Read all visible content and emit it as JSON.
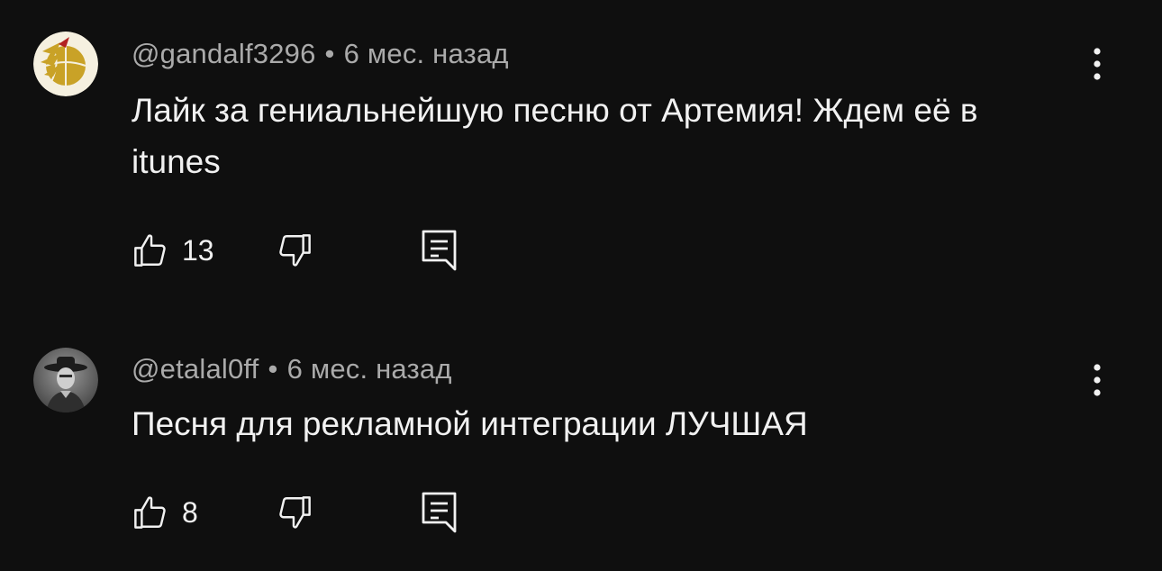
{
  "comments": [
    {
      "author": "@gandalf3296",
      "separator": "•",
      "time": "6 мес. назад",
      "text": "Лайк за гениальнейшую песню от Артемия! Ждем её в itunes",
      "likes": "13",
      "avatar_icon": "raptors-claw-basketball-icon"
    },
    {
      "author": "@etalal0ff",
      "separator": "•",
      "time": "6 мес. назад",
      "text": "Песня для рекламной интеграции ЛУЧШАЯ",
      "likes": "8",
      "avatar_icon": "cowboy-portrait-icon"
    }
  ],
  "colors": {
    "background": "#0f0f0f",
    "primary_text": "#f1f1f1",
    "secondary_text": "#aaaaaa",
    "avatar1_bg": "#f5f0e0",
    "avatar1_accent": "#c9a227"
  }
}
